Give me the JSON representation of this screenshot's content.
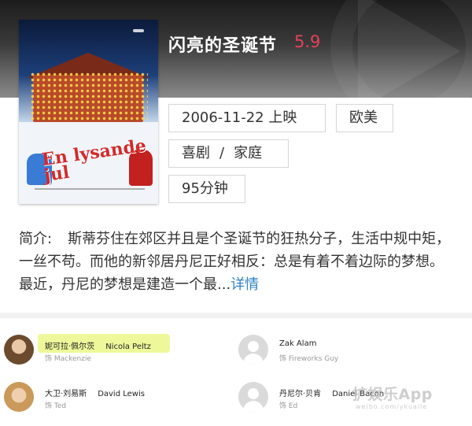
{
  "movie": {
    "title": "闪亮的圣诞节",
    "rating": "5.9",
    "release_date": "2006-11-22 上映",
    "region": "欧美",
    "genres": [
      "喜剧",
      "家庭"
    ],
    "genre_separator": "/",
    "duration": "95分钟",
    "poster_title": "En lysande jul"
  },
  "synopsis": {
    "label": "简介:",
    "text": "斯蒂芬住在郊区并且是个圣诞节的狂热分子，生活中规中矩，一丝不苟。而他的新邻居丹尼正好相反：总是有着不着边际的梦想。最近，丹尼的梦想是建造一个最...",
    "more_link": "详情"
  },
  "cast": [
    {
      "name_cn": "妮可拉·佩尔茨",
      "name_en": "Nicola Peltz",
      "role": "饰 Mackenzie",
      "avatar": "photo"
    },
    {
      "name_cn": "Zak Alam",
      "name_en": "",
      "role": "饰 Fireworks Guy",
      "avatar": "placeholder"
    },
    {
      "name_cn": "大卫·刘易斯",
      "name_en": "David Lewis",
      "role": "饰 Ted",
      "avatar": "photo"
    },
    {
      "name_cn": "丹尼尔·贝肯",
      "name_en": "Daniel Bacon",
      "role": "饰 Ed",
      "avatar": "placeholder"
    }
  ],
  "watermark": {
    "text": "扩娱乐App",
    "subtext": "weibo.com/ykuaile"
  },
  "colors": {
    "rating": "#e5425a",
    "link": "#2f84c6",
    "highlight": "#e8f578"
  }
}
